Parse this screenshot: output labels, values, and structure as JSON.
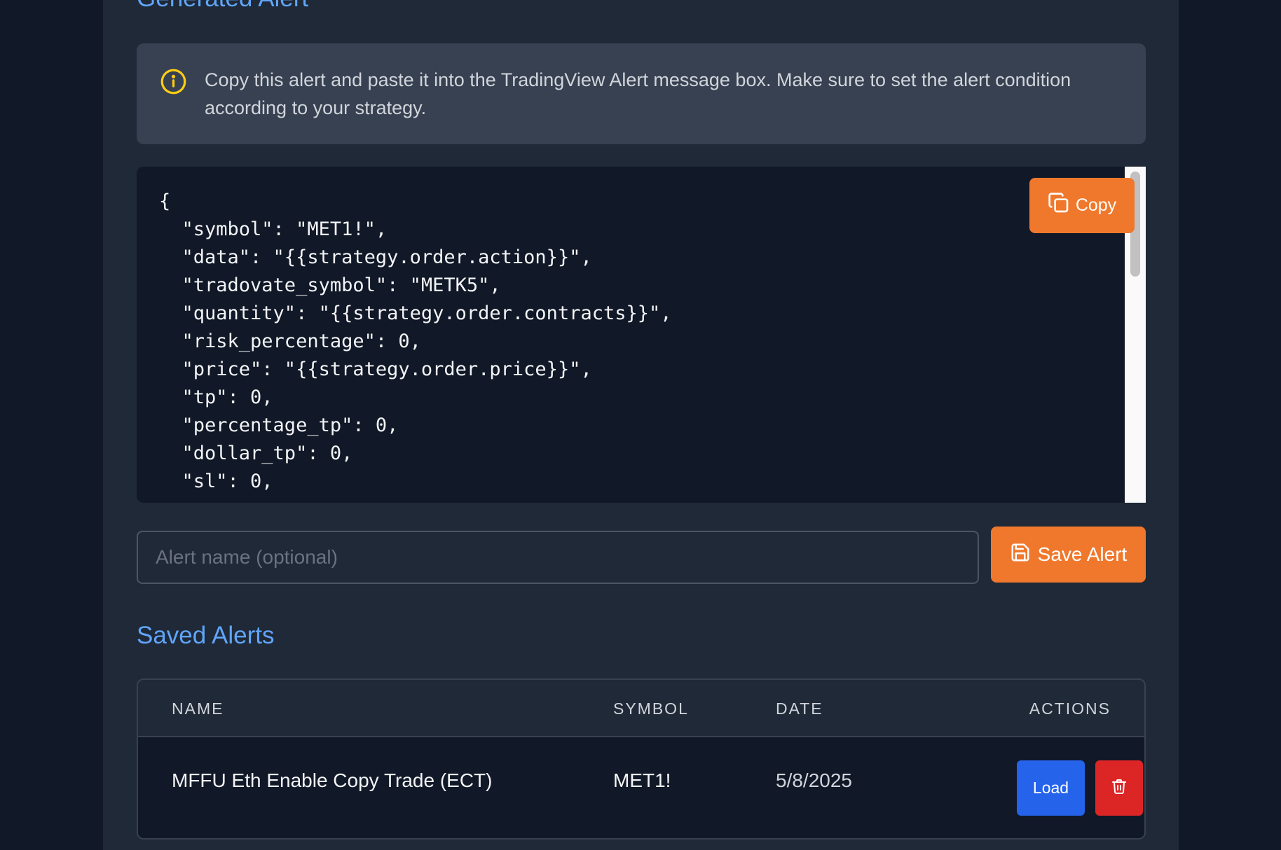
{
  "generated": {
    "title": "Generated Alert",
    "info_icon": "info-circle-icon",
    "info_text": "Copy this alert and paste it into the TradingView Alert message box. Make sure to set the alert condition according to your strategy.",
    "code": "{\n  \"symbol\": \"MET1!\",\n  \"data\": \"{{strategy.order.action}}\",\n  \"tradovate_symbol\": \"METK5\",\n  \"quantity\": \"{{strategy.order.contracts}}\",\n  \"risk_percentage\": 0,\n  \"price\": \"{{strategy.order.price}}\",\n  \"tp\": 0,\n  \"percentage_tp\": 0,\n  \"dollar_tp\": 0,\n  \"sl\": 0,",
    "copy_label": "Copy",
    "copy_icon": "copy-icon"
  },
  "save": {
    "placeholder": "Alert name (optional)",
    "value": "",
    "button_label": "Save Alert",
    "button_icon": "save-icon"
  },
  "saved_alerts": {
    "title": "Saved Alerts",
    "columns": [
      "NAME",
      "SYMBOL",
      "DATE",
      "ACTIONS"
    ],
    "rows": [
      {
        "name": "MFFU Eth Enable Copy Trade (ECT)",
        "symbol": "MET1!",
        "date": "5/8/2025",
        "load_label": "Load",
        "delete_icon": "trash-icon"
      }
    ]
  },
  "colors": {
    "accent_orange": "#f0782c",
    "title_blue": "#60a5fa",
    "load_blue": "#2563eb",
    "delete_red": "#dc2626",
    "info_yellow": "#facc15"
  }
}
